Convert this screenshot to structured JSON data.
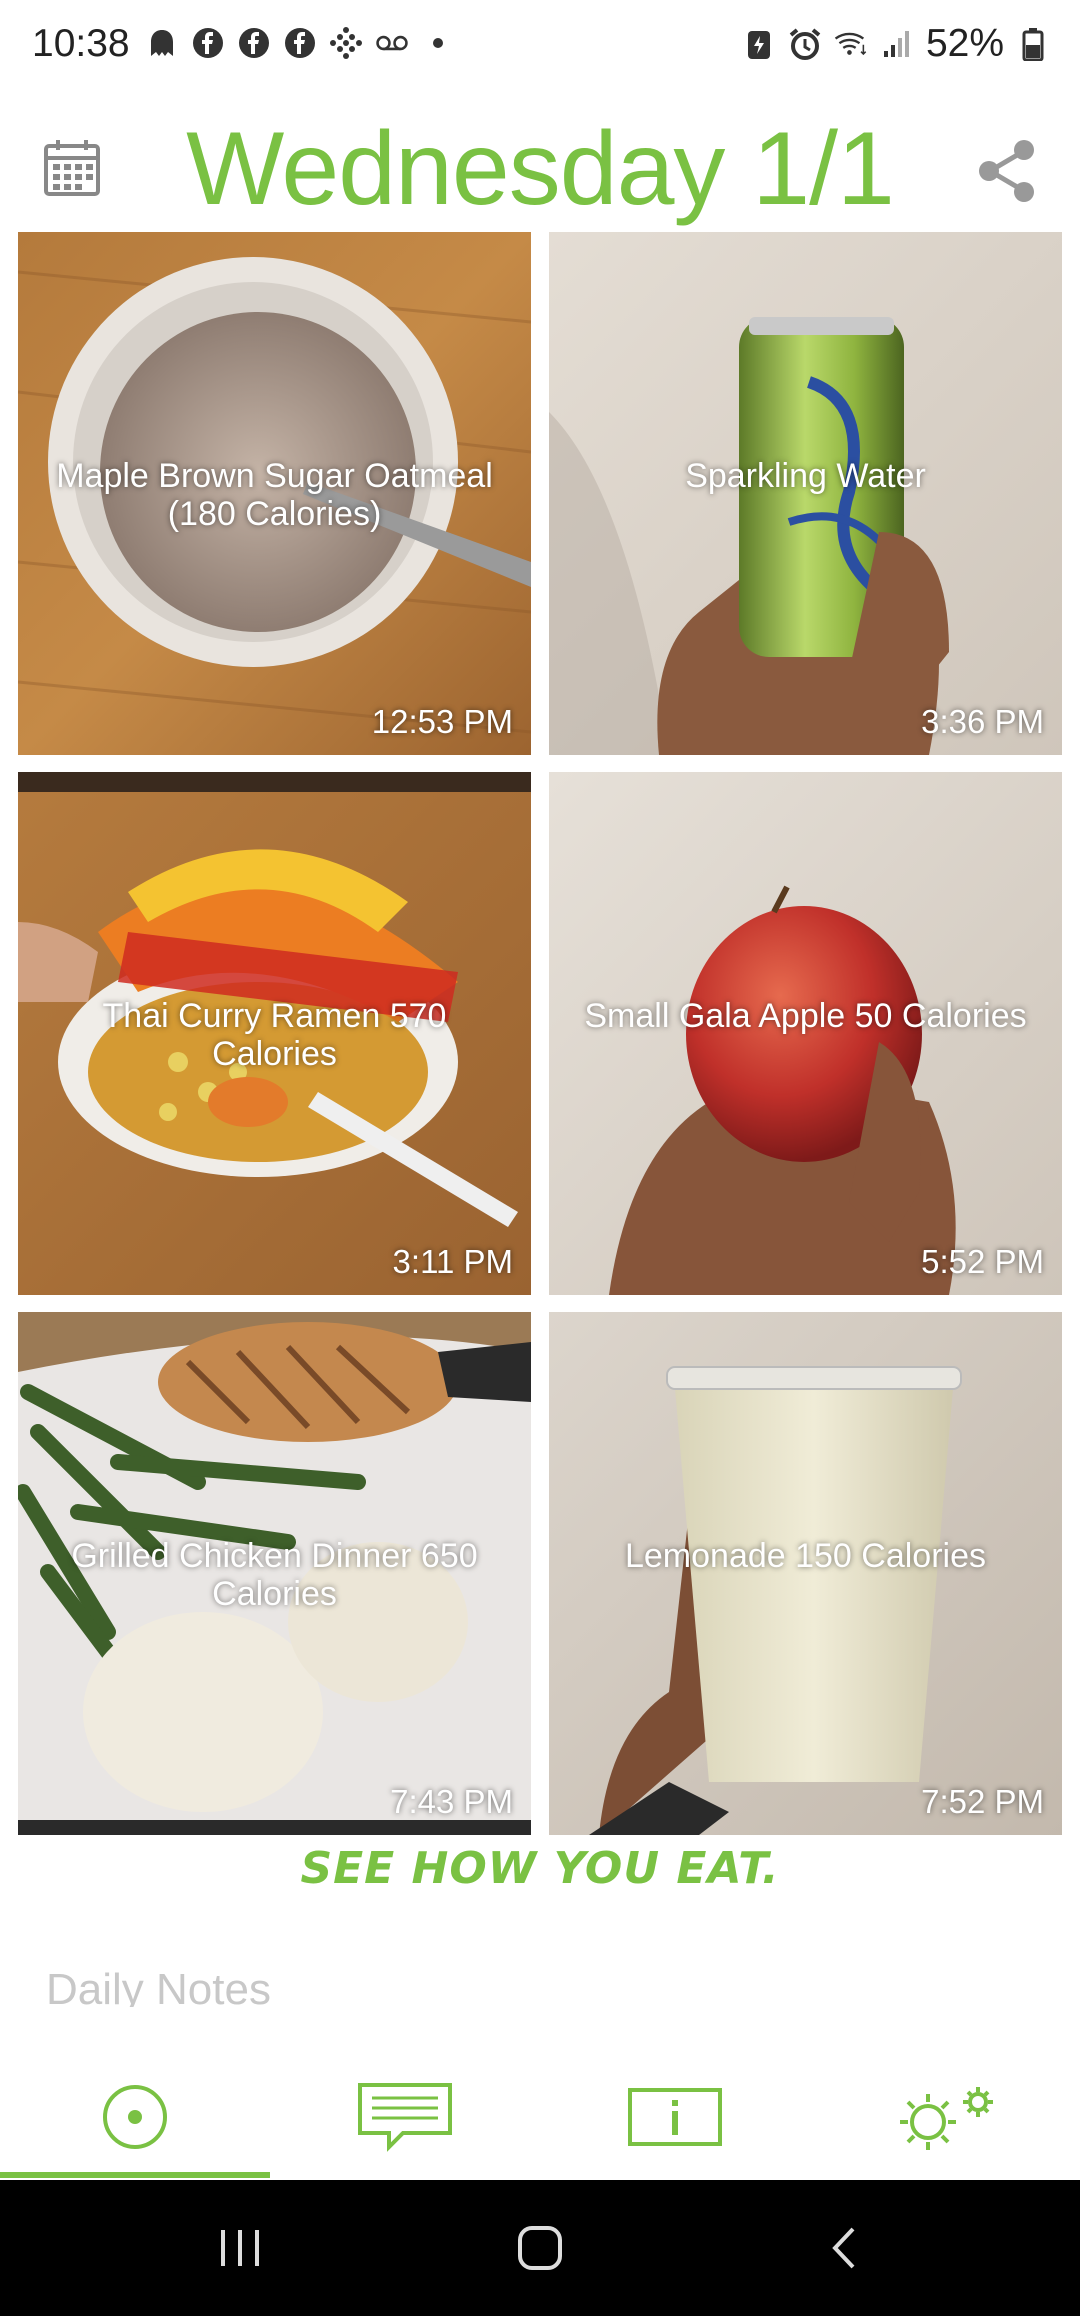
{
  "status_bar": {
    "time": "10:38",
    "battery": "52%"
  },
  "header": {
    "title": "Wednesday 1/1"
  },
  "meals": [
    {
      "label": "Maple Brown Sugar Oatmeal (180 Calories)",
      "time": "12:53 PM"
    },
    {
      "label": "Sparkling Water",
      "time": "3:36 PM"
    },
    {
      "label": "Thai Curry Ramen 570 Calories",
      "time": "3:11 PM"
    },
    {
      "label": "Small Gala Apple 50 Calories",
      "time": "5:52 PM"
    },
    {
      "label": "Grilled Chicken Dinner 650 Calories",
      "time": "7:43 PM"
    },
    {
      "label": "Lemonade 150 Calories",
      "time": "7:52 PM"
    }
  ],
  "tagline": "SEE HOW YOU EAT.",
  "notes": {
    "label": "Daily Notes"
  },
  "colors": {
    "accent": "#7ac143",
    "navbar": "#000000"
  },
  "bottom_nav": [
    "home-icon",
    "notes-icon",
    "info-icon",
    "settings-icon"
  ]
}
